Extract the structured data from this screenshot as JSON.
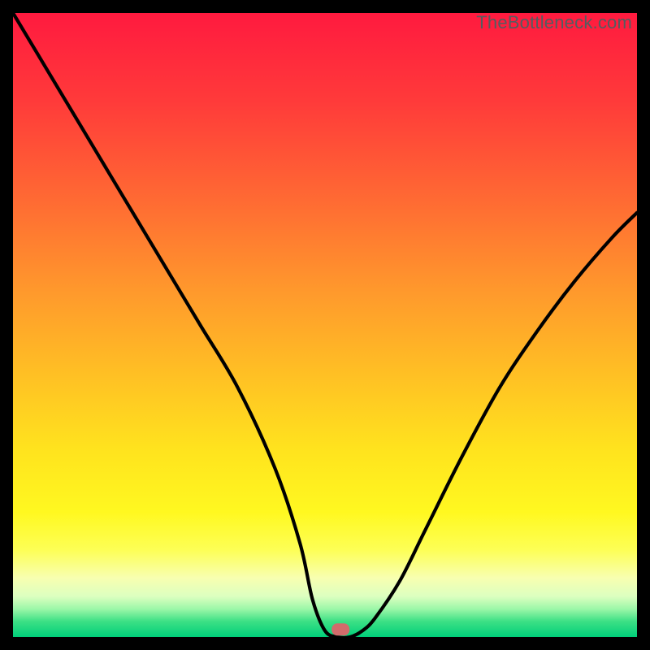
{
  "watermark": "TheBottleneck.com",
  "chart_data": {
    "type": "line",
    "title": "",
    "xlabel": "",
    "ylabel": "",
    "xlim": [
      0,
      100
    ],
    "ylim": [
      0,
      100
    ],
    "series": [
      {
        "name": "bottleneck-curve",
        "x": [
          0,
          6,
          12,
          18,
          24,
          30,
          36,
          42,
          46,
          48,
          50,
          52,
          54,
          56,
          58,
          62,
          66,
          72,
          78,
          84,
          90,
          96,
          100
        ],
        "values": [
          100,
          90,
          80,
          70,
          60,
          50,
          40,
          27,
          15,
          6,
          1,
          0,
          0,
          1,
          3,
          9,
          17,
          29,
          40,
          49,
          57,
          64,
          68
        ]
      }
    ],
    "marker": {
      "x": 52.5,
      "y": 1.2
    },
    "gradient_stops": [
      {
        "offset": 0.0,
        "color": "#ff1a3f"
      },
      {
        "offset": 0.14,
        "color": "#ff3a3a"
      },
      {
        "offset": 0.3,
        "color": "#ff6a33"
      },
      {
        "offset": 0.45,
        "color": "#ff9a2c"
      },
      {
        "offset": 0.58,
        "color": "#ffc024"
      },
      {
        "offset": 0.7,
        "color": "#ffe31e"
      },
      {
        "offset": 0.8,
        "color": "#fff820"
      },
      {
        "offset": 0.86,
        "color": "#fdff55"
      },
      {
        "offset": 0.905,
        "color": "#f8ffb0"
      },
      {
        "offset": 0.935,
        "color": "#dcffc0"
      },
      {
        "offset": 0.955,
        "color": "#9cf7a8"
      },
      {
        "offset": 0.975,
        "color": "#3ce085"
      },
      {
        "offset": 1.0,
        "color": "#00cf7a"
      }
    ]
  }
}
